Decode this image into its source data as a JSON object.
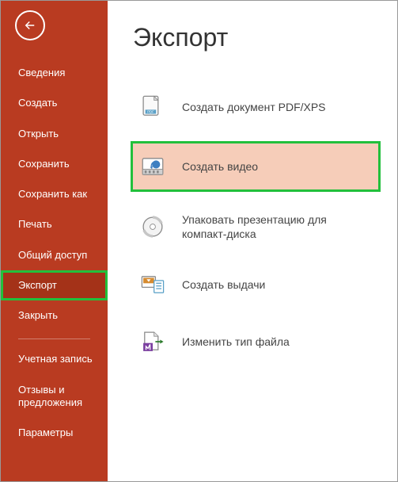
{
  "sidebar": {
    "items": [
      {
        "label": "Сведения"
      },
      {
        "label": "Создать"
      },
      {
        "label": "Открыть"
      },
      {
        "label": "Сохранить"
      },
      {
        "label": "Сохранить как"
      },
      {
        "label": "Печать"
      },
      {
        "label": "Общий доступ"
      },
      {
        "label": "Экспорт"
      },
      {
        "label": "Закрыть"
      }
    ],
    "footer": [
      {
        "label": "Учетная запись"
      },
      {
        "label": "Отзывы и предложения"
      },
      {
        "label": "Параметры"
      }
    ]
  },
  "main": {
    "title": "Экспорт",
    "options": [
      {
        "label": "Создать документ PDF/XPS"
      },
      {
        "label": "Создать видео"
      },
      {
        "label": "Упаковать презентацию для компакт-диска"
      },
      {
        "label": "Создать выдачи"
      },
      {
        "label": "Изменить тип файла"
      }
    ]
  }
}
